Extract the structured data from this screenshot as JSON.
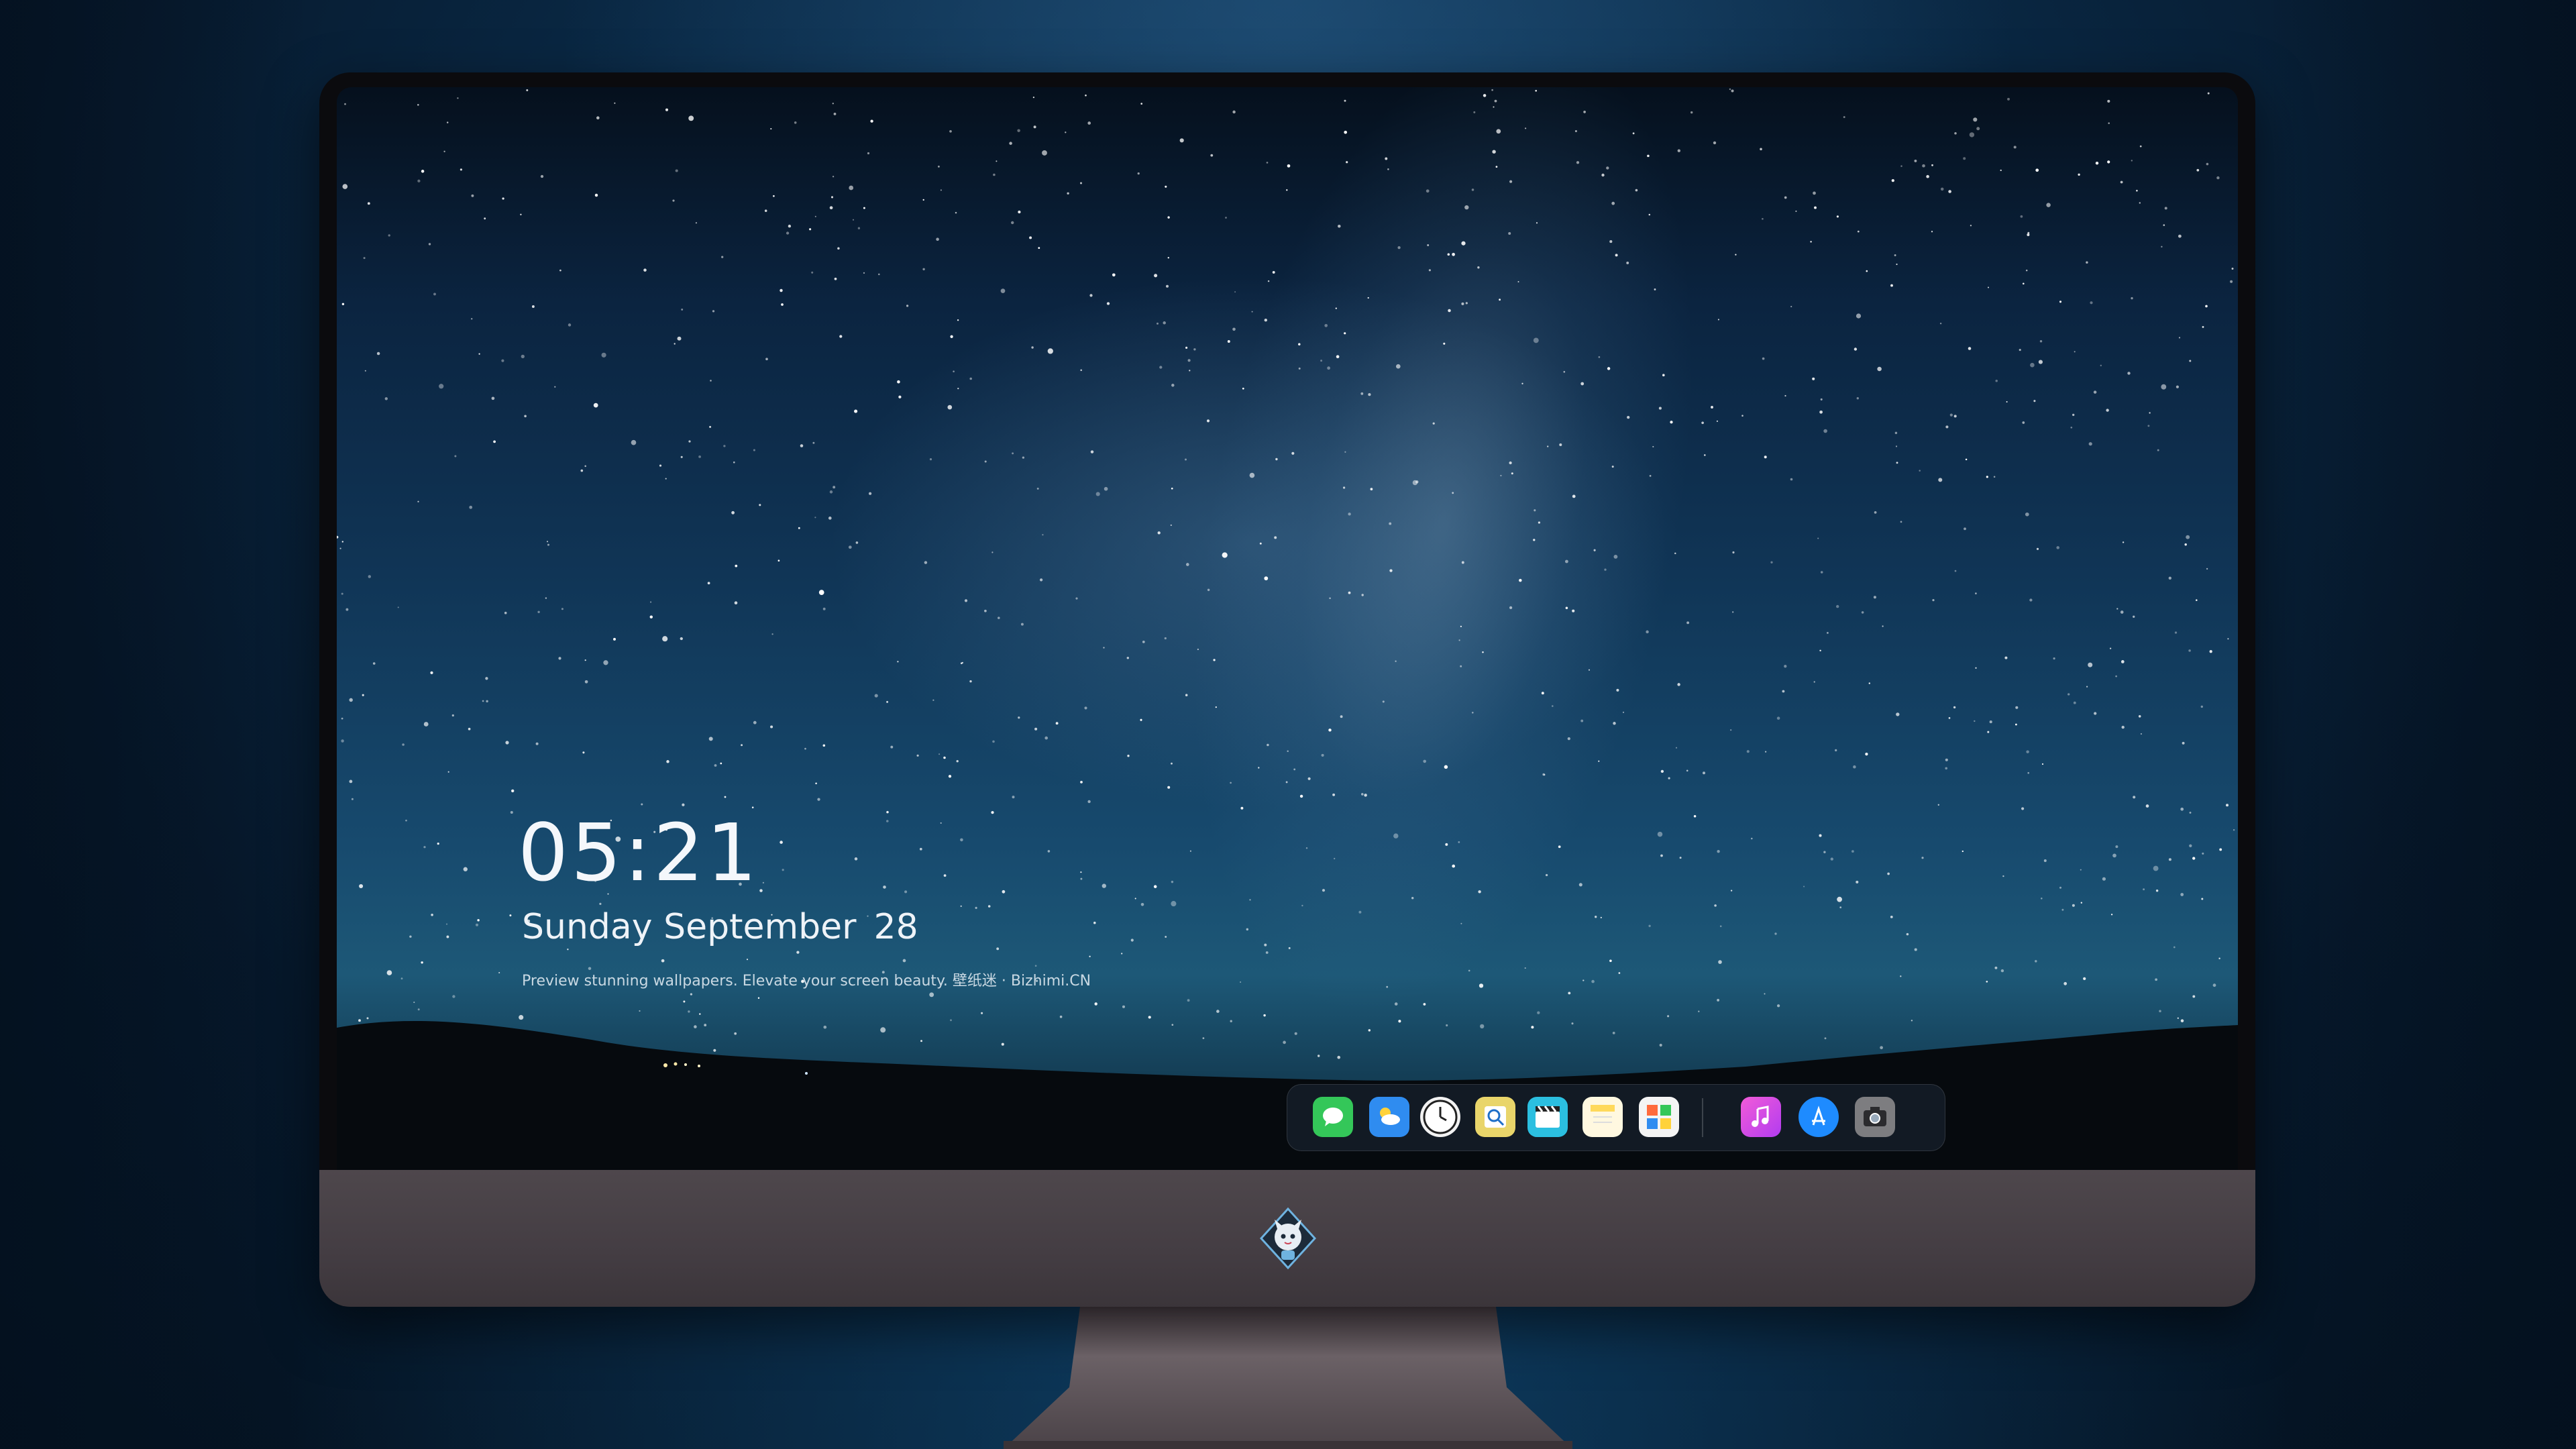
{
  "lockscreen": {
    "time": "05:21",
    "date_weekday_month": "Sunday September",
    "date_day": "28",
    "tagline": "Preview stunning wallpapers. Elevate your screen beauty. 壁纸迷 · Bizhimi.CN"
  },
  "dock": {
    "apps": [
      {
        "name": "messages-icon",
        "color": "#34c759"
      },
      {
        "name": "weather-icon",
        "color": "#2f8cf0"
      },
      {
        "name": "clock-icon",
        "color": "#f2f2f2"
      },
      {
        "name": "preview-icon",
        "color": "#e9d56a"
      },
      {
        "name": "clips-icon",
        "color": "#2bbfe0"
      },
      {
        "name": "notes-icon",
        "color": "#ffd95a"
      },
      {
        "name": "photo-booth-icon",
        "color": "#ff6a3c"
      },
      {
        "name": "music-icon",
        "color": "#e43be8"
      },
      {
        "name": "app-store-icon",
        "color": "#1e8bff"
      },
      {
        "name": "camera-icon",
        "color": "#7d7d80"
      }
    ]
  },
  "device": {
    "chin_color": "#4b4449",
    "bezel_color": "#0b0b0e"
  }
}
